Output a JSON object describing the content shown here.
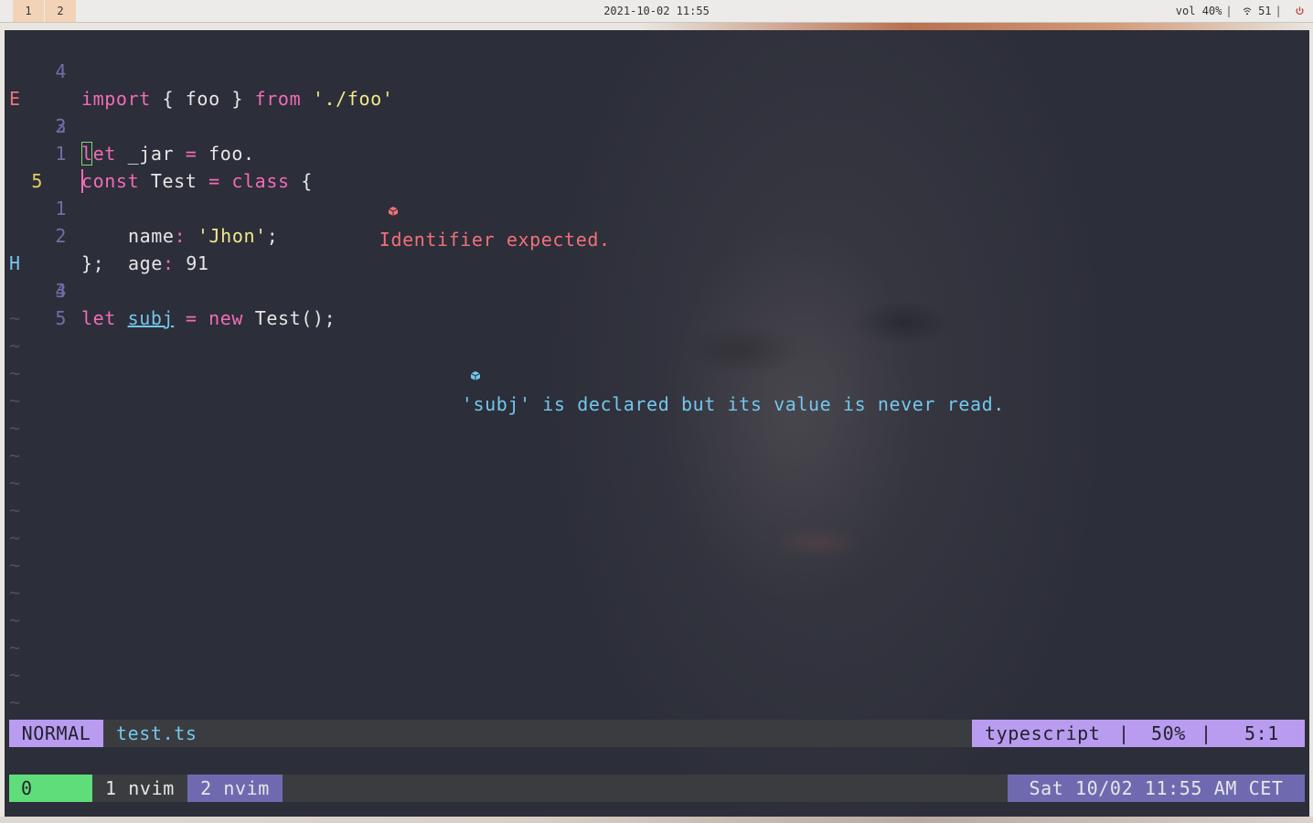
{
  "topbar": {
    "workspaces": [
      "1",
      "2"
    ],
    "datetime": "2021-10-02 11:55",
    "volume": "vol 40%",
    "wifi_icon": "wifi-icon",
    "wifi": "51",
    "separator": "|",
    "power_icon": "power-icon"
  },
  "editor": {
    "lines": {
      "l1": {
        "num": "4",
        "kw1": "import",
        "t1": " { foo } ",
        "kw2": "from",
        "t2": " ",
        "str": "'./foo'"
      },
      "l2": {
        "sign": "E",
        "num": "3",
        "kw1": "let",
        "t1": " _jar ",
        "op": "=",
        "t2": " foo.",
        "diag_icon": "diagnostic-error-icon",
        "diag": "Identifier expected."
      },
      "l3": {
        "num": "2"
      },
      "l4": {
        "num": "1",
        "kw1": "const",
        "t1": " Test ",
        "op": "=",
        "t2": " ",
        "kw2": "class",
        "t3": " {"
      },
      "l5": {
        "num": "5",
        "prop": "name",
        "colon": ":",
        "t1": " ",
        "str": "'Jhon'",
        "t2": ";"
      },
      "l6": {
        "num": "1",
        "prop": "age",
        "colon": ":",
        "t1": " 91"
      },
      "l7": {
        "num": "2",
        "t1": "};"
      },
      "l8": {
        "sign": "H",
        "num": "3",
        "kw1": "let",
        "t1": " ",
        "ul": "subj",
        "t2": " ",
        "op": "=",
        "t3": " ",
        "kw2": "new",
        "t4": " Test();",
        "diag_icon": "diagnostic-hint-icon",
        "diag": "'subj' is declared but its value is never read."
      },
      "l9": {
        "num": "4"
      },
      "l10": {
        "num": "5"
      }
    },
    "tilde": "~"
  },
  "statusline": {
    "mode": "NORMAL",
    "filename": "test.ts",
    "filetype": "typescript",
    "sep": "|",
    "percent": "50%",
    "position": "5:1"
  },
  "tmux": {
    "session": "0",
    "window1": "1 nvim",
    "window2": "2 nvim",
    "clock": "Sat 10/02 11:55 AM CET"
  },
  "colors": {
    "terminal_bg": "#2c2e39",
    "keyword": "#f06cb7",
    "string": "#f1e98a",
    "error": "#f07178",
    "hint": "#73c7ec",
    "mode_bg": "#b99cf0",
    "session_bg": "#5fdd7b",
    "window_active_bg": "#6f6ab0"
  }
}
